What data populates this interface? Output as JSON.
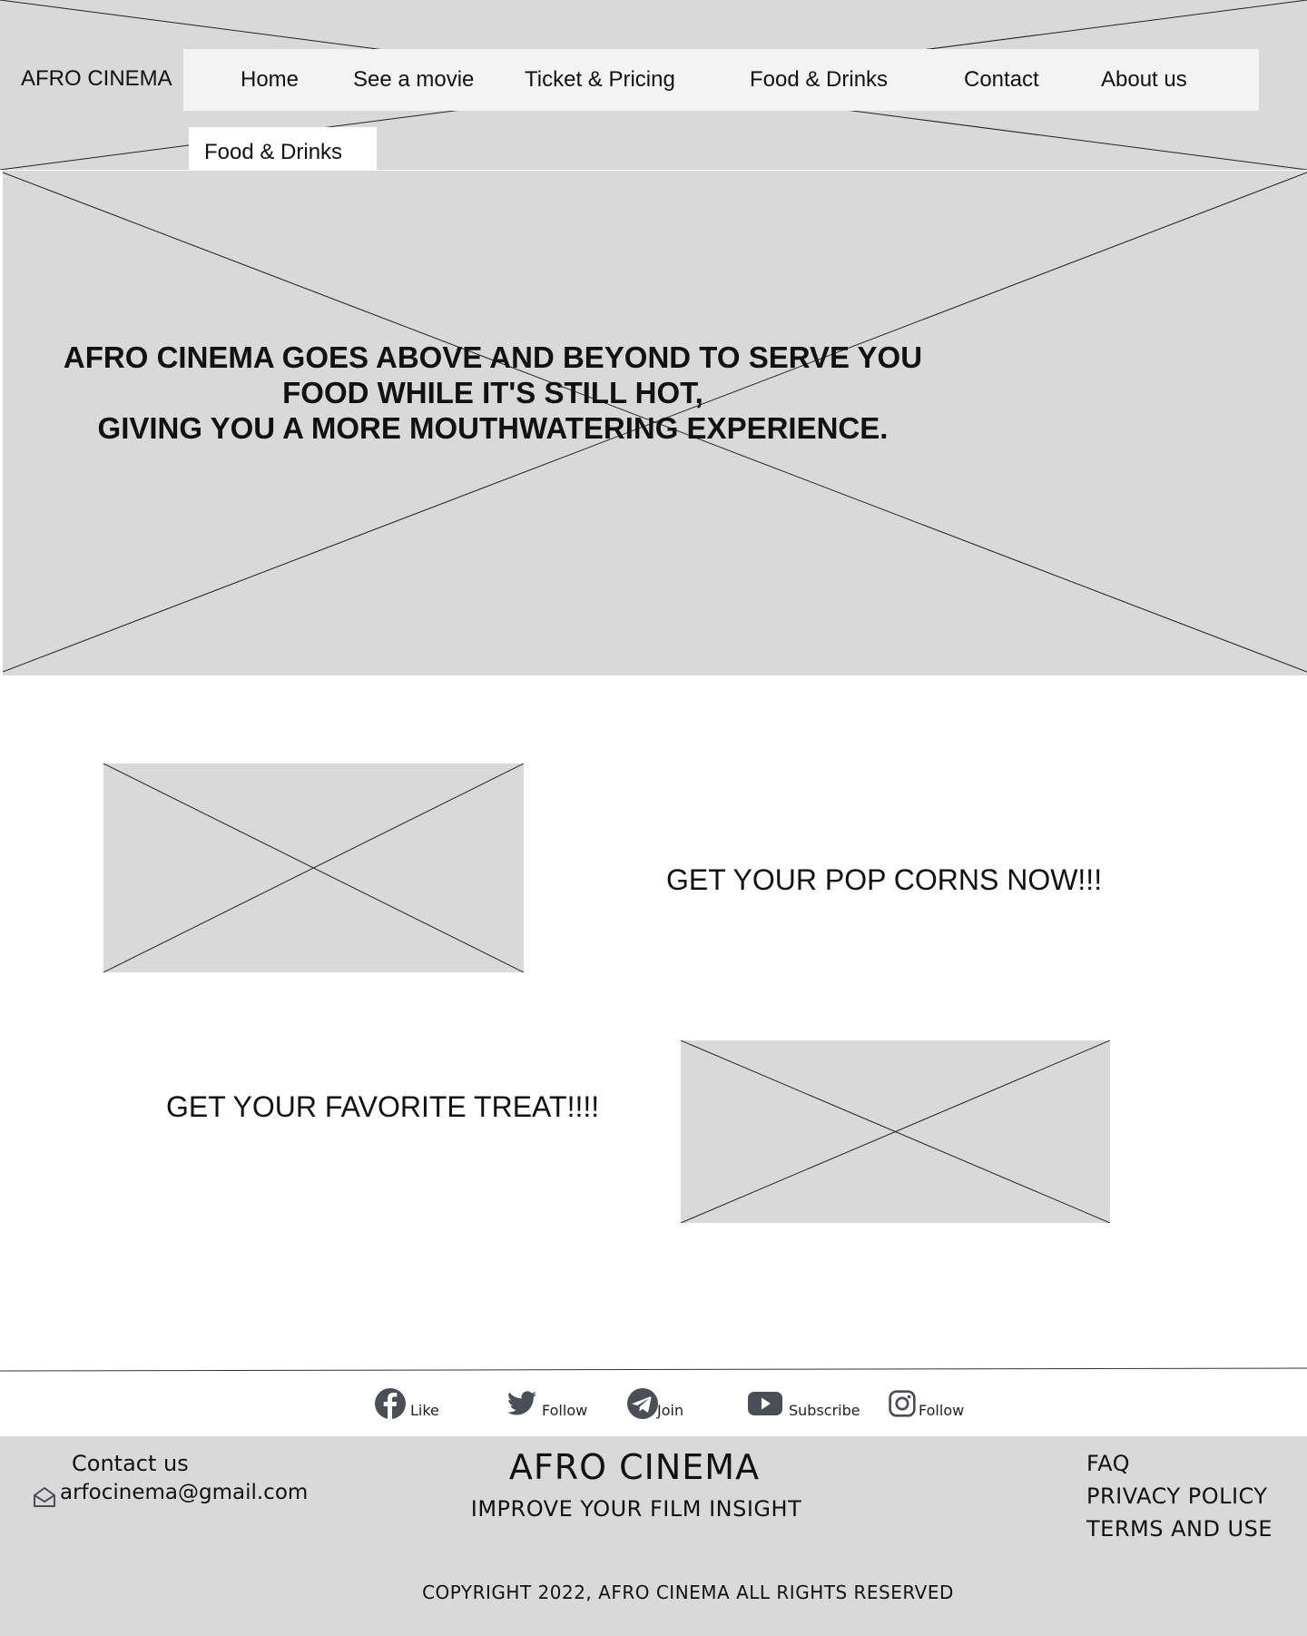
{
  "header": {
    "logo": "AFRO CINEMA",
    "nav": [
      "Home",
      "See a movie",
      "Ticket & Pricing",
      "Food & Drinks",
      "Contact",
      "About us"
    ],
    "dropdown_item": "Food & Drinks"
  },
  "hero": {
    "lines": [
      "AFRO CINEMA GOES ABOVE AND BEYOND TO SERVE YOU",
      "FOOD WHILE IT'S STILL HOT,",
      "GIVING YOU A MORE MOUTHWATERING EXPERIENCE."
    ]
  },
  "promos": {
    "popcorn": "GET YOUR POP CORNS NOW!!!",
    "treat": "GET YOUR FAVORITE TREAT!!!!"
  },
  "social": [
    {
      "icon": "facebook-icon",
      "label": "Like"
    },
    {
      "icon": "twitter-icon",
      "label": "Follow"
    },
    {
      "icon": "telegram-icon",
      "label": "Join"
    },
    {
      "icon": "youtube-icon",
      "label": "Subscribe"
    },
    {
      "icon": "instagram-icon",
      "label": "Follow"
    }
  ],
  "footer": {
    "contact_title": "Contact us",
    "email": "arfocinema@gmail.com",
    "brand": "AFRO CINEMA",
    "tagline": "IMPROVE YOUR FILM INSIGHT",
    "links": [
      "FAQ",
      "PRIVACY POLICY",
      "TERMS AND USE"
    ],
    "copyright": "COPYRIGHT 2022, AFRO CINEMA ALL RIGHTS RESERVED"
  },
  "colors": {
    "placeholder": "#d9d9d9",
    "navbar": "#f3f3f3",
    "icon": "#4a4f57"
  }
}
